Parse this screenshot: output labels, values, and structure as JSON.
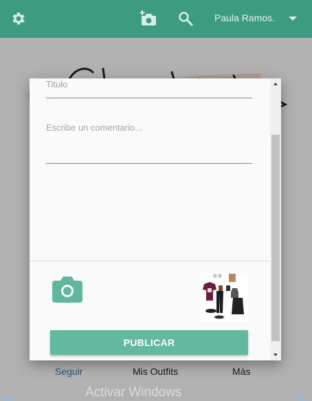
{
  "appbar": {
    "user_name": "Paula Ramos.",
    "accent_color": "#3d9b7f",
    "icons": [
      "gear-icon",
      "add-photo-icon",
      "search-icon",
      "chevron-down-icon"
    ]
  },
  "dialog": {
    "title_placeholder": "Titulo",
    "comment_placeholder": "Escribe un comentario...",
    "publish_label": "PUBLICAR",
    "button_color": "#63b9a0",
    "icons": [
      "camera-icon"
    ]
  },
  "tabs": {
    "follow_label": "Seguir",
    "outfits_label": "Mis Outfits",
    "more_label": "Más"
  },
  "watermark": "Activar Windows"
}
